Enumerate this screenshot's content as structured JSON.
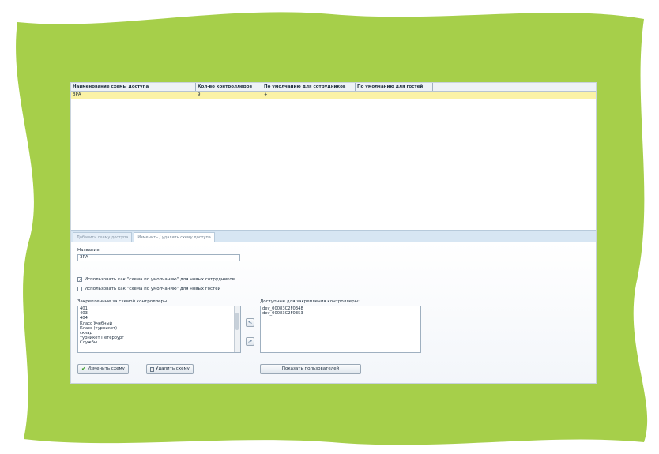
{
  "frame": {
    "color": "#a6cf4a"
  },
  "grid": {
    "columns": [
      "Наименование схемы доступа",
      "Кол-во контроллеров",
      "По умолчанию для сотрудников",
      "По умолчанию для гостей"
    ],
    "rows": [
      {
        "name": "ЗРА",
        "count": "9",
        "default_staff": "+",
        "default_guest": ""
      }
    ]
  },
  "tabs": [
    "Добавить схему доступа",
    "Изменить / удалить схему доступа"
  ],
  "form": {
    "name_label": "Название:",
    "name_value": "ЗРА",
    "check_staff_label": "Использовать как \"схема по умолчанию\" для новых сотрудников",
    "check_staff_mark": "✓",
    "check_guest_label": "Использовать как \"схема по умолчанию\" для новых гостей",
    "assigned_label": "Закрепленные за схемой контроллеры:",
    "assigned_items": [
      "401",
      "403",
      "404",
      "Класс Учебный",
      "Класс (турникет)",
      "склад",
      "турникет Петербург",
      "Службы"
    ],
    "available_label": "Доступные для закрепления контроллеры:",
    "available_items": [
      "dev_00083C2F0348",
      "dev_00083C2F0353"
    ],
    "move_left": "<",
    "move_right": ">"
  },
  "buttons": {
    "edit": "Изменить схему",
    "delete": "Удалить схему",
    "show_users": "Показать пользователей"
  }
}
